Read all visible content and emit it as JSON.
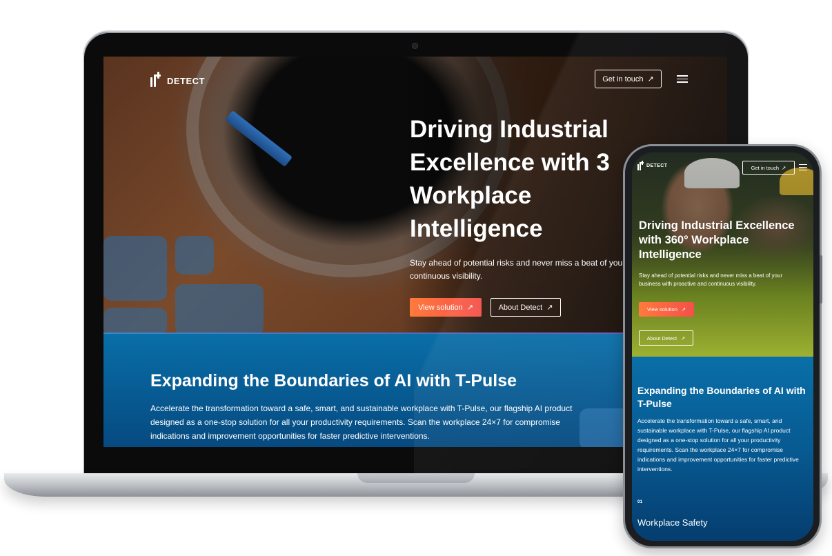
{
  "brand": {
    "name": "DETECT",
    "accent_gradient": [
      "#ff7a3d",
      "#f4504a"
    ],
    "band_color": "#0a6fa8"
  },
  "laptop": {
    "header": {
      "cta_label": "Get in touch",
      "cta_icon": "arrow-up-right-icon",
      "menu_icon": "hamburger-menu-icon"
    },
    "hero": {
      "title": "Driving Industrial\nExcellence with 3\nWorkplace\nIntelligence",
      "subtitle": "Stay ahead of potential risks and never miss a beat of your bu proactive and continuous visibility.",
      "primary_button": "View solution",
      "secondary_button": "About Detect"
    },
    "section": {
      "heading": "Expanding the Boundaries of AI with T-Pulse",
      "paragraph": "Accelerate the transformation toward a safe, smart, and sustainable workplace with T-Pulse, our flagship AI product designed as a one-stop solution for all your productivity requirements. Scan the workplace 24×7 for compromise indications and improvement opportunities for faster predictive interventions."
    }
  },
  "phone": {
    "header": {
      "cta_label": "Get in touch",
      "cta_icon": "arrow-up-right-icon",
      "menu_icon": "hamburger-menu-icon"
    },
    "hero": {
      "title": "Driving Industrial Excellence\nwith 360° Workplace\nIntelligence",
      "subtitle": "Stay ahead of potential risks and never miss a beat of your business with proactive and continuous visibility.",
      "primary_button": "View solution",
      "secondary_button": "About Detect"
    },
    "section": {
      "heading": "Expanding the Boundaries of AI with T-Pulse",
      "paragraph": "Accelerate the transformation toward a safe, smart, and sustainable workplace with T-Pulse, our flagship AI product designed as a one-stop solution for all your productivity requirements. Scan the workplace 24×7 for compromise indications and improvement opportunities for faster predictive interventions.",
      "feature_number": "01",
      "feature_title": "Workplace Safety"
    }
  }
}
